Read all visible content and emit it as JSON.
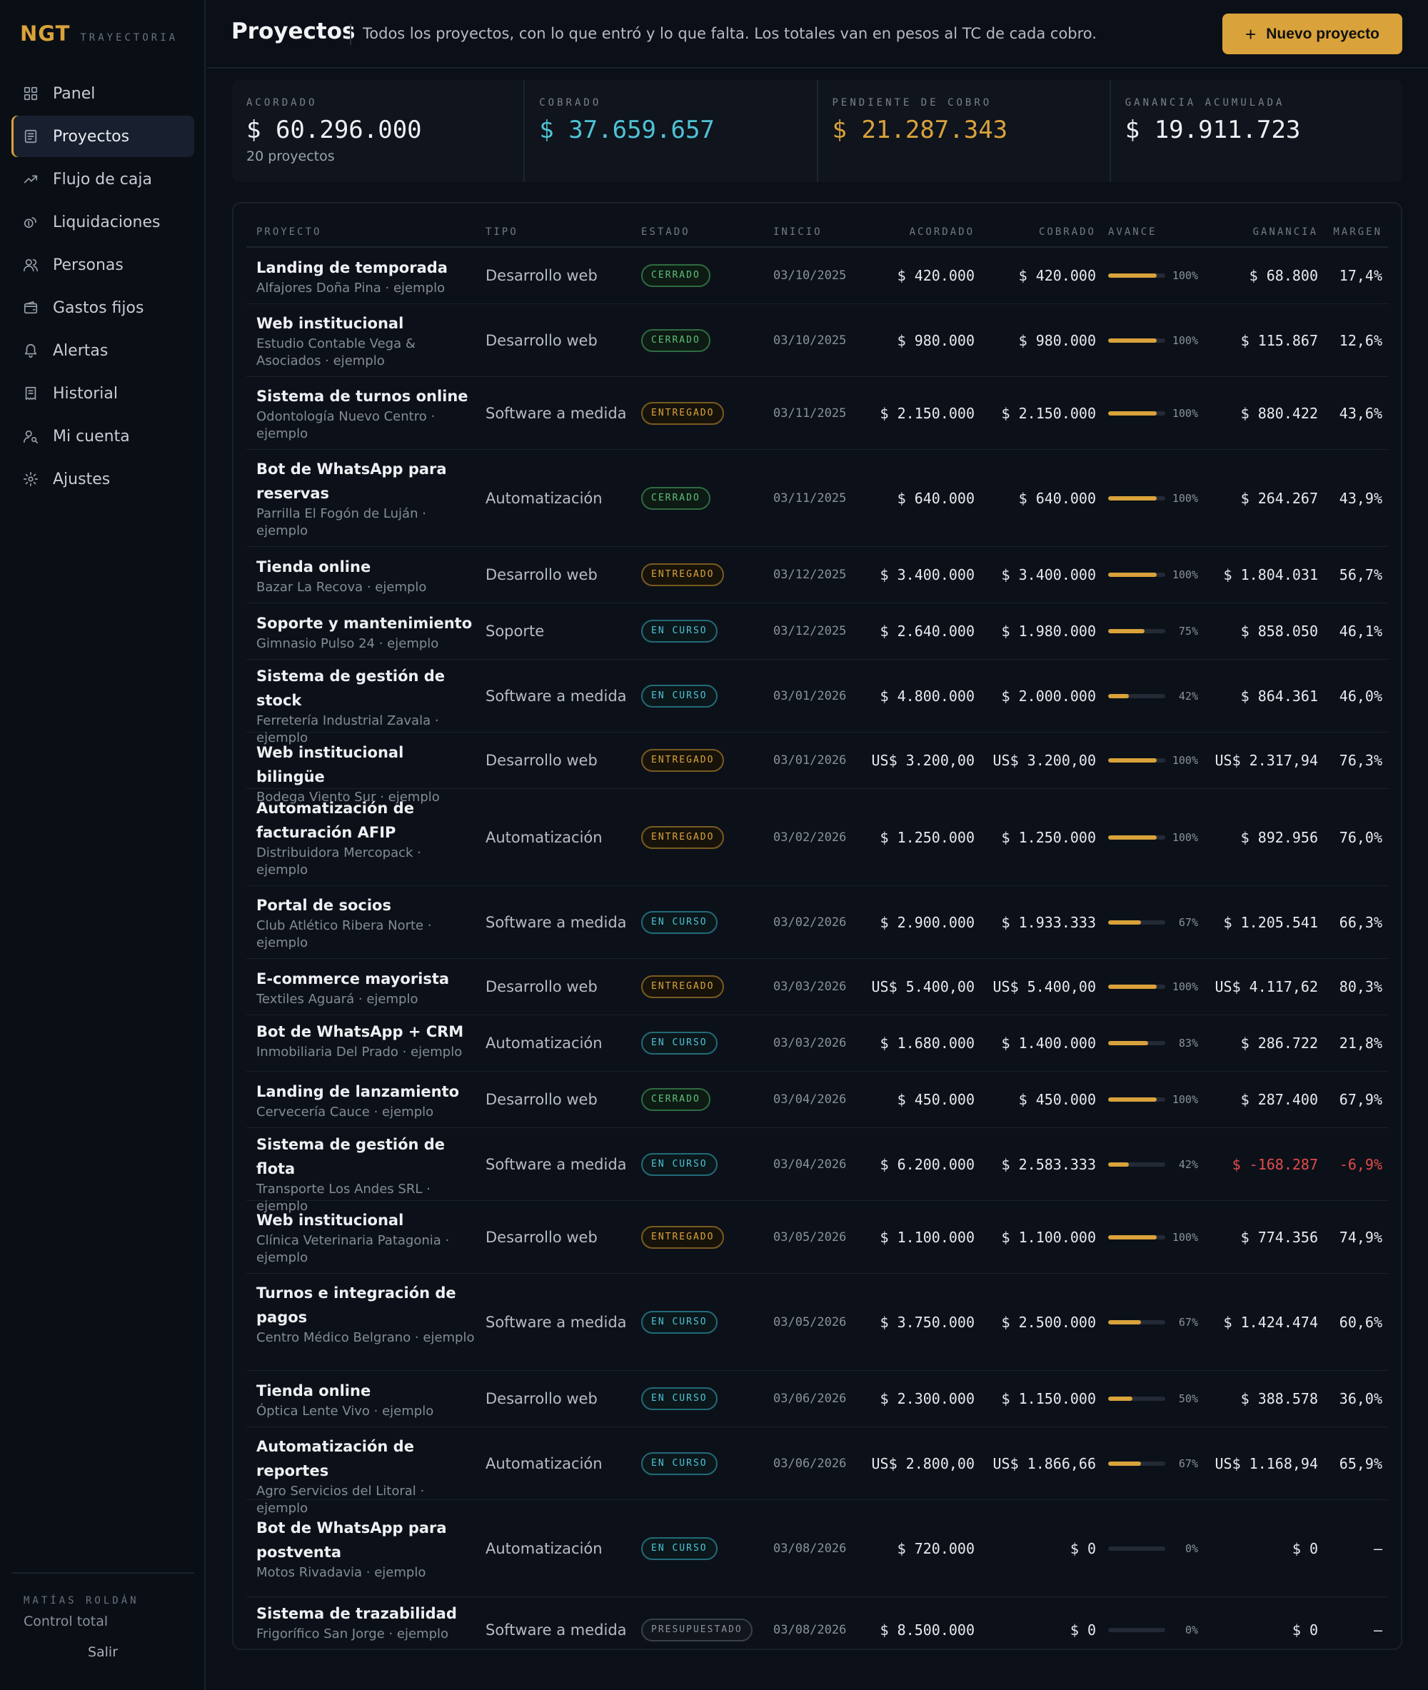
{
  "sidebar": {
    "brand": "NGT",
    "brand_sub": "TRAYECTORIA",
    "items": [
      {
        "label": "Panel",
        "icon": "grid-icon",
        "active": false
      },
      {
        "label": "Proyectos",
        "icon": "document-icon",
        "active": true
      },
      {
        "label": "Flujo de caja",
        "icon": "trend-icon",
        "active": false
      },
      {
        "label": "Liquidaciones",
        "icon": "coins-icon",
        "active": false
      },
      {
        "label": "Personas",
        "icon": "users-icon",
        "active": false
      },
      {
        "label": "Gastos fijos",
        "icon": "wallet-icon",
        "active": false
      },
      {
        "label": "Alertas",
        "icon": "bell-icon",
        "active": false
      },
      {
        "label": "Historial",
        "icon": "receipt-icon",
        "active": false
      },
      {
        "label": "Mi cuenta",
        "icon": "user-key-icon",
        "active": false
      },
      {
        "label": "Ajustes",
        "icon": "gear-icon",
        "active": false
      }
    ],
    "user_name": "MATÍAS ROLDÁN",
    "user_role": "Control total",
    "logout": "Salir"
  },
  "header": {
    "title": "Proyectos",
    "description": "Todos los proyectos, con lo que entró y lo que falta. Los totales van en pesos al TC de cada cobro.",
    "new_button": "Nuevo proyecto"
  },
  "stats": [
    {
      "label": "ACORDADO",
      "value": "$ 60.296.000",
      "sub": "20 proyectos",
      "color": "#eef0f3"
    },
    {
      "label": "COBRADO",
      "value": "$ 37.659.657",
      "sub": "",
      "color": "#4fc3d6"
    },
    {
      "label": "PENDIENTE DE COBRO",
      "value": "$ 21.287.343",
      "sub": "",
      "color": "#d9a23b"
    },
    {
      "label": "GANANCIA ACUMULADA",
      "value": "$ 19.911.723",
      "sub": "",
      "color": "#eef0f3"
    }
  ],
  "table": {
    "headers": {
      "proyecto": "PROYECTO",
      "tipo": "TIPO",
      "estado": "ESTADO",
      "inicio": "INICIO",
      "acordado": "ACORDADO",
      "cobrado": "COBRADO",
      "avance": "AVANCE",
      "ganancia": "GANANCIA",
      "margen": "MARGEN"
    },
    "rows": [
      {
        "name": "Landing de temporada",
        "client": "Alfajores Doña Pina · ejemplo",
        "tipo": "Desarrollo web",
        "estado": "CERRADO",
        "inicio": "03/10/2025",
        "acordado": "$ 420.000",
        "cobrado": "$ 420.000",
        "avance": 100,
        "avance_label": "100%",
        "ganancia": "$ 68.800",
        "margen": "17,4%"
      },
      {
        "name": "Web institucional",
        "client": "Estudio Contable Vega & Asociados · ejemplo",
        "tipo": "Desarrollo web",
        "estado": "CERRADO",
        "inicio": "03/10/2025",
        "acordado": "$ 980.000",
        "cobrado": "$ 980.000",
        "avance": 100,
        "avance_label": "100%",
        "ganancia": "$ 115.867",
        "margen": "12,6%"
      },
      {
        "name": "Sistema de turnos online",
        "client": "Odontología Nuevo Centro · ejemplo",
        "tipo": "Software a medida",
        "estado": "ENTREGADO",
        "inicio": "03/11/2025",
        "acordado": "$ 2.150.000",
        "cobrado": "$ 2.150.000",
        "avance": 100,
        "avance_label": "100%",
        "ganancia": "$ 880.422",
        "margen": "43,6%"
      },
      {
        "name": "Bot de WhatsApp para reservas",
        "client": "Parrilla El Fogón de Luján · ejemplo",
        "tipo": "Automatización",
        "estado": "CERRADO",
        "inicio": "03/11/2025",
        "acordado": "$ 640.000",
        "cobrado": "$ 640.000",
        "avance": 100,
        "avance_label": "100%",
        "ganancia": "$ 264.267",
        "margen": "43,9%"
      },
      {
        "name": "Tienda online",
        "client": "Bazar La Recova · ejemplo",
        "tipo": "Desarrollo web",
        "estado": "ENTREGADO",
        "inicio": "03/12/2025",
        "acordado": "$ 3.400.000",
        "cobrado": "$ 3.400.000",
        "avance": 100,
        "avance_label": "100%",
        "ganancia": "$ 1.804.031",
        "margen": "56,7%"
      },
      {
        "name": "Soporte y mantenimiento",
        "client": "Gimnasio Pulso 24 · ejemplo",
        "tipo": "Soporte",
        "estado": "EN CURSO",
        "inicio": "03/12/2025",
        "acordado": "$ 2.640.000",
        "cobrado": "$ 1.980.000",
        "avance": 75,
        "avance_label": "75%",
        "ganancia": "$ 858.050",
        "margen": "46,1%"
      },
      {
        "name": "Sistema de gestión de stock",
        "client": "Ferretería Industrial Zavala · ejemplo",
        "tipo": "Software a medida",
        "estado": "EN CURSO",
        "inicio": "03/01/2026",
        "acordado": "$ 4.800.000",
        "cobrado": "$ 2.000.000",
        "avance": 42,
        "avance_label": "42%",
        "ganancia": "$ 864.361",
        "margen": "46,0%"
      },
      {
        "name": "Web institucional bilingüe",
        "client": "Bodega Viento Sur · ejemplo",
        "tipo": "Desarrollo web",
        "estado": "ENTREGADO",
        "inicio": "03/01/2026",
        "acordado": "US$ 3.200,00",
        "cobrado": "US$ 3.200,00",
        "avance": 100,
        "avance_label": "100%",
        "ganancia": "US$ 2.317,94",
        "margen": "76,3%"
      },
      {
        "name": "Automatización de facturación AFIP",
        "client": "Distribuidora Mercopack · ejemplo",
        "tipo": "Automatización",
        "estado": "ENTREGADO",
        "inicio": "03/02/2026",
        "acordado": "$ 1.250.000",
        "cobrado": "$ 1.250.000",
        "avance": 100,
        "avance_label": "100%",
        "ganancia": "$ 892.956",
        "margen": "76,0%"
      },
      {
        "name": "Portal de socios",
        "client": "Club Atlético Ribera Norte · ejemplo",
        "tipo": "Software a medida",
        "estado": "EN CURSO",
        "inicio": "03/02/2026",
        "acordado": "$ 2.900.000",
        "cobrado": "$ 1.933.333",
        "avance": 67,
        "avance_label": "67%",
        "ganancia": "$ 1.205.541",
        "margen": "66,3%"
      },
      {
        "name": "E-commerce mayorista",
        "client": "Textiles Aguará · ejemplo",
        "tipo": "Desarrollo web",
        "estado": "ENTREGADO",
        "inicio": "03/03/2026",
        "acordado": "US$ 5.400,00",
        "cobrado": "US$ 5.400,00",
        "avance": 100,
        "avance_label": "100%",
        "ganancia": "US$ 4.117,62",
        "margen": "80,3%"
      },
      {
        "name": "Bot de WhatsApp + CRM",
        "client": "Inmobiliaria Del Prado · ejemplo",
        "tipo": "Automatización",
        "estado": "EN CURSO",
        "inicio": "03/03/2026",
        "acordado": "$ 1.680.000",
        "cobrado": "$ 1.400.000",
        "avance": 83,
        "avance_label": "83%",
        "ganancia": "$ 286.722",
        "margen": "21,8%"
      },
      {
        "name": "Landing de lanzamiento",
        "client": "Cervecería Cauce · ejemplo",
        "tipo": "Desarrollo web",
        "estado": "CERRADO",
        "inicio": "03/04/2026",
        "acordado": "$ 450.000",
        "cobrado": "$ 450.000",
        "avance": 100,
        "avance_label": "100%",
        "ganancia": "$ 287.400",
        "margen": "67,9%"
      },
      {
        "name": "Sistema de gestión de flota",
        "client": "Transporte Los Andes SRL · ejemplo",
        "tipo": "Software a medida",
        "estado": "EN CURSO",
        "inicio": "03/04/2026",
        "acordado": "$ 6.200.000",
        "cobrado": "$ 2.583.333",
        "avance": 42,
        "avance_label": "42%",
        "ganancia": "$ -168.287",
        "margen": "-6,9%",
        "negative": true
      },
      {
        "name": "Web institucional",
        "client": "Clínica Veterinaria Patagonia · ejemplo",
        "tipo": "Desarrollo web",
        "estado": "ENTREGADO",
        "inicio": "03/05/2026",
        "acordado": "$ 1.100.000",
        "cobrado": "$ 1.100.000",
        "avance": 100,
        "avance_label": "100%",
        "ganancia": "$ 774.356",
        "margen": "74,9%"
      },
      {
        "name": "Turnos e integración de pagos",
        "client": "Centro Médico Belgrano · ejemplo",
        "tipo": "Software a medida",
        "estado": "EN CURSO",
        "inicio": "03/05/2026",
        "acordado": "$ 3.750.000",
        "cobrado": "$ 2.500.000",
        "avance": 67,
        "avance_label": "67%",
        "ganancia": "$ 1.424.474",
        "margen": "60,6%"
      },
      {
        "name": "Tienda online",
        "client": "Óptica Lente Vivo · ejemplo",
        "tipo": "Desarrollo web",
        "estado": "EN CURSO",
        "inicio": "03/06/2026",
        "acordado": "$ 2.300.000",
        "cobrado": "$ 1.150.000",
        "avance": 50,
        "avance_label": "50%",
        "ganancia": "$ 388.578",
        "margen": "36,0%"
      },
      {
        "name": "Automatización de reportes",
        "client": "Agro Servicios del Litoral · ejemplo",
        "tipo": "Automatización",
        "estado": "EN CURSO",
        "inicio": "03/06/2026",
        "acordado": "US$ 2.800,00",
        "cobrado": "US$ 1.866,66",
        "avance": 67,
        "avance_label": "67%",
        "ganancia": "US$ 1.168,94",
        "margen": "65,9%"
      },
      {
        "name": "Bot de WhatsApp para postventa",
        "client": "Motos Rivadavia · ejemplo",
        "tipo": "Automatización",
        "estado": "EN CURSO",
        "inicio": "03/08/2026",
        "acordado": "$ 720.000",
        "cobrado": "$ 0",
        "avance": 0,
        "avance_label": "0%",
        "ganancia": "$ 0",
        "margen": "—"
      },
      {
        "name": "Sistema de trazabilidad",
        "client": "Frigorífico San Jorge · ejemplo",
        "tipo": "Software a medida",
        "estado": "PRESUPUESTADO",
        "inicio": "03/08/2026",
        "acordado": "$ 8.500.000",
        "cobrado": "$ 0",
        "avance": 0,
        "avance_label": "0%",
        "ganancia": "$ 0",
        "margen": "—"
      }
    ]
  },
  "colors": {
    "accent": "#d9a23b",
    "cyan": "#4fc3d6",
    "green": "#5cc07a",
    "negative": "#e24b4b",
    "background": "#0b0f17"
  }
}
